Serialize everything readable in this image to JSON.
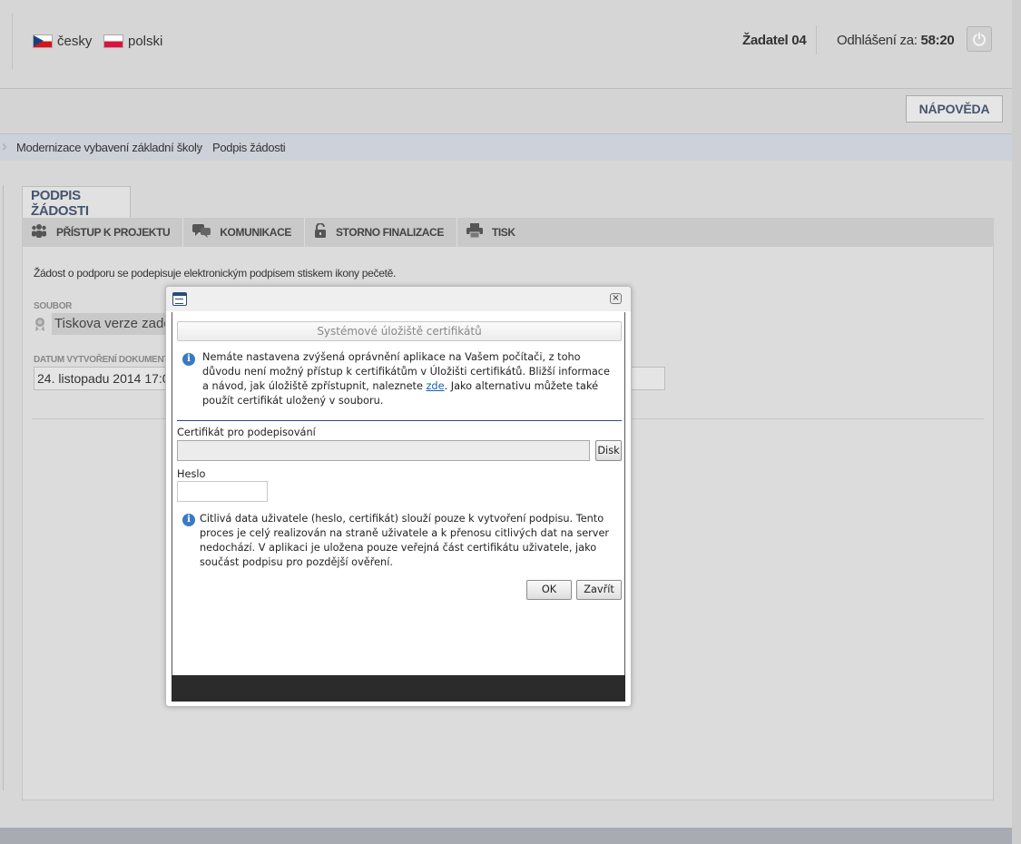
{
  "header": {
    "languages": [
      {
        "label": "česky",
        "flag_icon": "czech-flag-icon"
      },
      {
        "label": "polski",
        "flag_icon": "polish-flag-icon"
      }
    ],
    "user": "Žadatel 04",
    "logout_label": "Odhlášení za:",
    "logout_time": "58:20",
    "power_icon": "power-icon"
  },
  "helpbar": {
    "help_label": "NÁPOVĚDA"
  },
  "breadcrumb": [
    "Modernizace vybavení základní školy",
    "Podpis žádosti"
  ],
  "page": {
    "tab_label": "PODPIS ŽÁDOSTI",
    "toolbar": [
      {
        "label": "PŘÍSTUP K PROJEKTU",
        "icon": "people-icon"
      },
      {
        "label": "KOMUNIKACE",
        "icon": "speech-bubbles-icon"
      },
      {
        "label": "STORNO FINALIZACE",
        "icon": "unlock-icon"
      },
      {
        "label": "TISK",
        "icon": "printer-icon"
      }
    ],
    "info_text": "Žádost o podporu se podepisuje elektronickým podpisem stiskem ikony pečetě.",
    "file_label": "SOUBOR",
    "file_value": "Tiskova verze zadosti",
    "date_label": "DATUM VYTVOŘENÍ DOKUMENTU",
    "date_value": "24. listopadu 2014 17:08:"
  },
  "dialog": {
    "app_icon": "window-icon",
    "close_icon": "close-icon",
    "cert_store_label": "Systémové úložiště certifikátů",
    "warning_text_before_link": "Nemáte nastavena zvýšená oprávnění aplikace na Vašem počítači, z toho důvodu není možný přístup k certifikátům v Úložišti certifikátů. Bližší informace a návod, jak úložiště zpřístupnit, naleznete ",
    "warning_link": "zde",
    "warning_text_after_link": ". Jako alternativu můžete také použít certifikát uložený v souboru.",
    "certificate_label": "Certifikát pro podepisování",
    "disk_button": "Disk",
    "password_label": "Heslo",
    "privacy_text": "Citlivá data uživatele (heslo, certifikát) slouží pouze k vytvoření podpisu. Tento proces je celý realizován na straně uživatele a k přenosu citlivých dat na server nedochází. V aplikaci je uložena pouze veřejná část certifikátu uživatele, jako součást podpisu pro pozdější ověření.",
    "ok_button": "OK",
    "close_button": "Zavřít"
  }
}
